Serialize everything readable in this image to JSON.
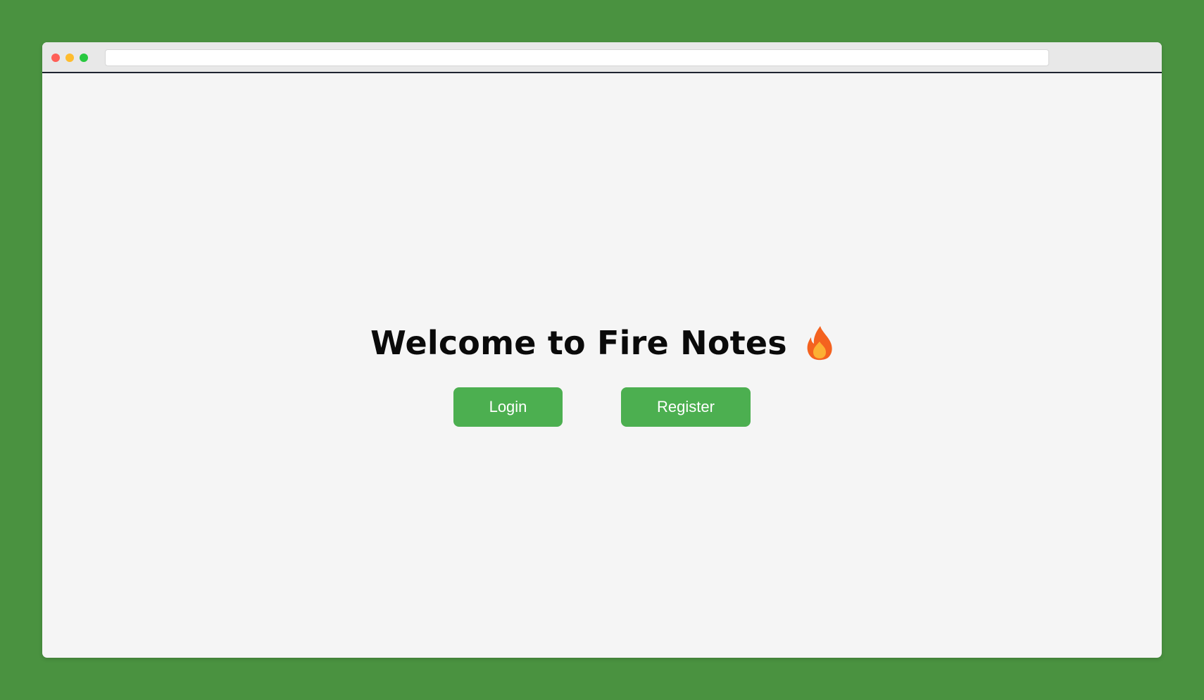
{
  "browser": {
    "address_value": "",
    "traffic_lights": [
      "close",
      "minimize",
      "maximize"
    ]
  },
  "hero": {
    "title": "Welcome to Fire Notes",
    "title_icon": "fire-icon"
  },
  "actions": {
    "login_label": "Login",
    "register_label": "Register"
  },
  "colors": {
    "page_background": "#4a9240",
    "content_background": "#f5f5f5",
    "button": "#4caf50",
    "button_text": "#ffffff",
    "flame_outer": "#f4621f",
    "flame_inner": "#fcb033"
  }
}
